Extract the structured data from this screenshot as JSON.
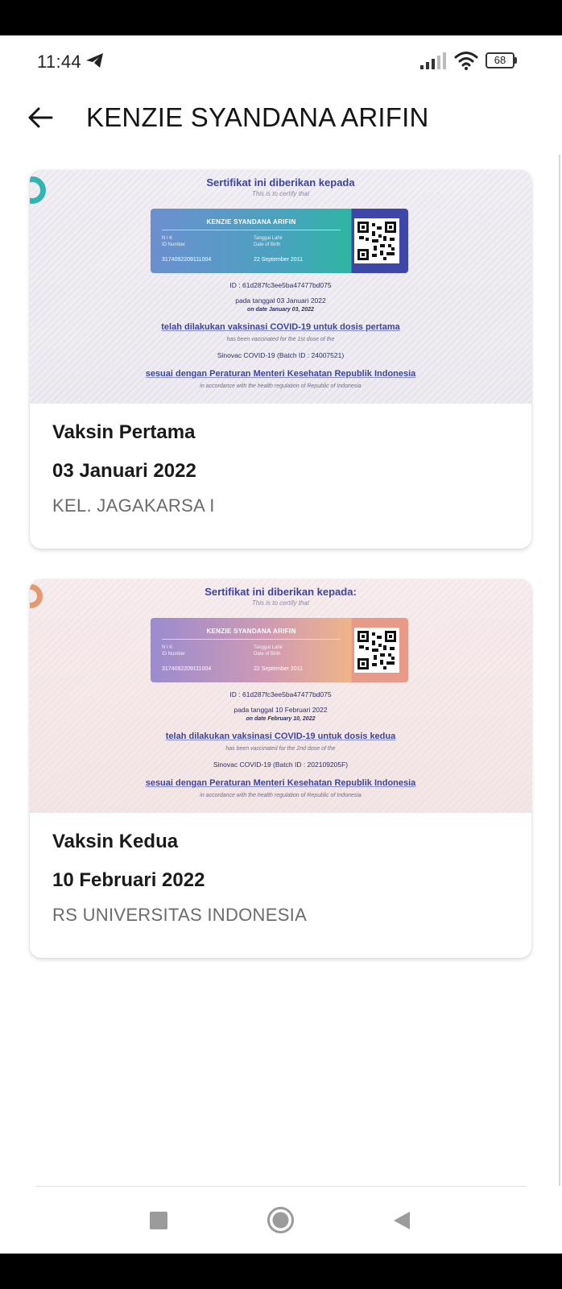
{
  "status_bar": {
    "time": "11:44",
    "battery": "68",
    "icons": [
      "telegram-icon",
      "signal-icon",
      "wifi-icon",
      "battery-icon"
    ]
  },
  "app_bar": {
    "title": "KENZIE SYANDANA ARIFIN",
    "back_icon": "arrow-left-icon"
  },
  "certificates": [
    {
      "heading": "Sertifikat ini diberikan kepada",
      "heading_en": "This is to certify that",
      "holder_name": "KENZIE SYANDANA ARIFIN",
      "nik_label": "N I K",
      "nik_label_en": "ID Number",
      "nik_value": "3174092209111004",
      "dob_label": "Tanggal Lahir",
      "dob_label_en": "Date of Birth",
      "dob_value": "22 September 2011",
      "cert_id": "ID : 61d287fc3ee5ba47477bd075",
      "date_line": "pada tanggal 03 Januari 2022",
      "date_line_en": "on date January 03, 2022",
      "vaccinated_line": "telah dilakukan vaksinasi COVID-19 untuk dosis pertama",
      "vaccinated_line_en": "has been vaccinated for the 1st dose of the",
      "vaccine_batch": "Sinovac COVID-19 (Batch ID : 24007521)",
      "regulation": "sesuai dengan Peraturan Menteri Kesehatan Republik Indonesia",
      "regulation_en": "in accordance with the health regulation of Republic of Indonesia",
      "dose_title": "Vaksin Pertama",
      "dose_date": "03 Januari 2022",
      "place": "KEL. JAGAKARSA I",
      "accent": "#34b3b3"
    },
    {
      "heading": "Sertifikat ini diberikan kepada:",
      "heading_en": "This is to certify that",
      "holder_name": "KENZIE SYANDANA ARIFIN",
      "nik_label": "N I K",
      "nik_label_en": "ID Number",
      "nik_value": "3174092209111004",
      "dob_label": "Tanggal Lahir",
      "dob_label_en": "Date of Birth",
      "dob_value": "22 September 2011",
      "cert_id": "ID : 61d287fc3ee5ba47477bd075",
      "date_line": "pada tanggal 10 Februari 2022",
      "date_line_en": "on date February 10, 2022",
      "vaccinated_line": "telah dilakukan vaksinasi COVID-19 untuk dosis kedua",
      "vaccinated_line_en": "has been vaccinated for the 2nd dose of the",
      "vaccine_batch": "Sinovac COVID-19 (Batch ID : 202109205F)",
      "regulation": "sesuai dengan Peraturan Menteri Kesehatan Republik Indonesia",
      "regulation_en": "in accordance with the health regulation of Republic of Indonesia",
      "dose_title": "Vaksin Kedua",
      "dose_date": "10 Februari 2022",
      "place": "RS UNIVERSITAS INDONESIA",
      "accent": "#e29a72"
    }
  ],
  "nav_bar": {
    "icons": [
      "recent-apps-icon",
      "home-icon",
      "back-icon"
    ]
  }
}
